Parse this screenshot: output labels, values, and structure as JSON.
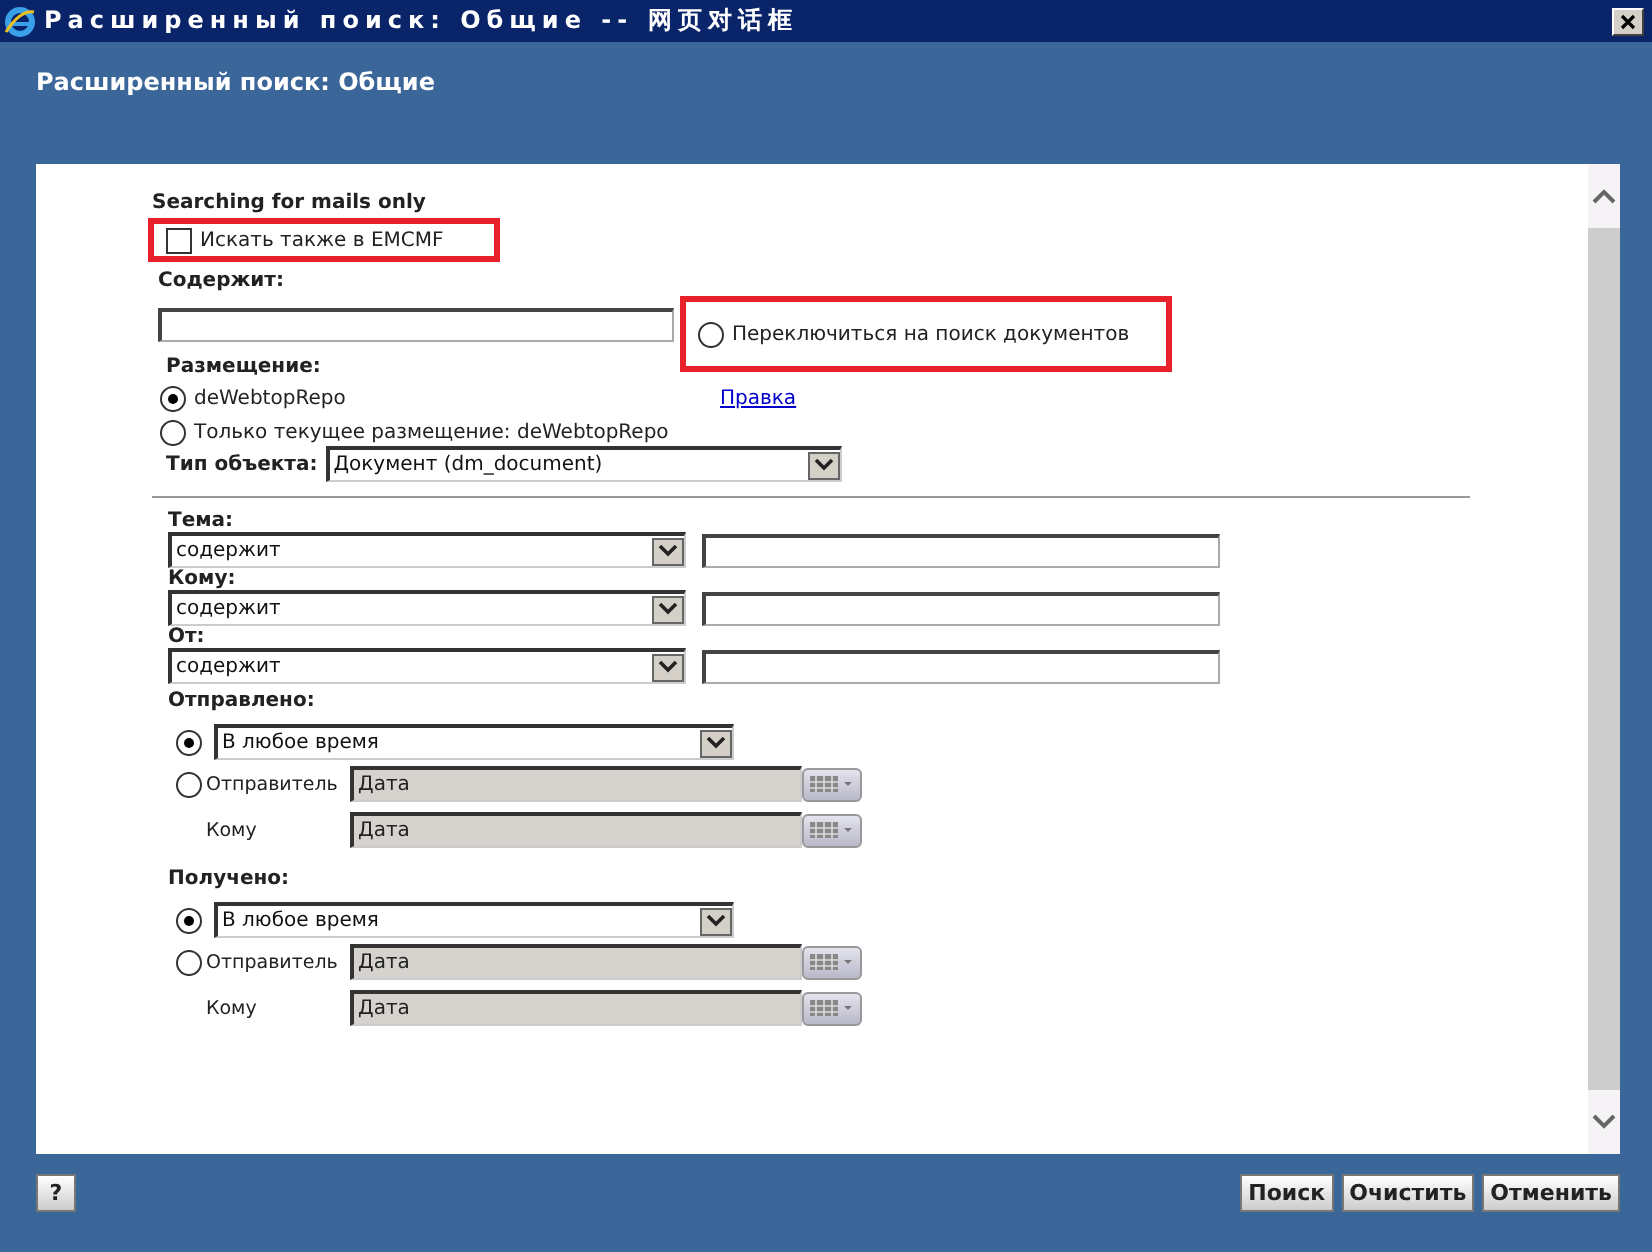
{
  "window": {
    "title": "Расширенный поиск: Общие -- 网页对话框"
  },
  "header": "Расширенный поиск: Общие",
  "note": "Searching for mails only",
  "emcmf": {
    "label": "Искать также в EMCMF",
    "checked": false
  },
  "contains": {
    "label": "Содержит:"
  },
  "switch_option": {
    "label": "Переключиться на поиск документов",
    "selected": false
  },
  "location": {
    "label": "Размещение:",
    "options": [
      {
        "label": "deWebtopRepo",
        "selected": true
      },
      {
        "label": "Только текущее размещение: deWebtopRepo",
        "selected": false
      }
    ],
    "edit_link": "Правка"
  },
  "object_type": {
    "label": "Тип объекта:",
    "value": "Документ (dm_document)"
  },
  "fields": [
    {
      "label": "Тема:",
      "operator": "содержит"
    },
    {
      "label": "Кому:",
      "operator": "содержит"
    },
    {
      "label": "От:",
      "operator": "содержит"
    }
  ],
  "date_groups": [
    {
      "label": "Отправлено:",
      "any": {
        "value": "В любое время",
        "selected": true
      },
      "range": {
        "selected": false,
        "rows": [
          {
            "label": "Отправитель",
            "placeholder": "Дата"
          },
          {
            "label": "Кому",
            "placeholder": "Дата"
          }
        ]
      }
    },
    {
      "label": "Получено:",
      "any": {
        "value": "В любое время",
        "selected": true
      },
      "range": {
        "selected": false,
        "rows": [
          {
            "label": "Отправитель",
            "placeholder": "Дата"
          },
          {
            "label": "Кому",
            "placeholder": "Дата"
          }
        ]
      }
    }
  ],
  "help_button": "?",
  "buttons": [
    "Поиск",
    "Очистить",
    "Отменить"
  ]
}
